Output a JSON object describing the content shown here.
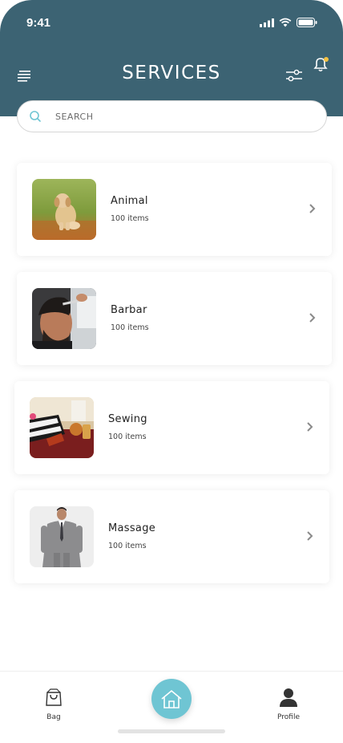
{
  "status_bar": {
    "time": "9:41"
  },
  "header": {
    "title": "SERVICES"
  },
  "search": {
    "placeholder": "SEARCH"
  },
  "services": [
    {
      "title": "Animal",
      "count": "100 items",
      "image": "puppy-photo"
    },
    {
      "title": "Barbar",
      "count": "100 items",
      "image": "barber-photo"
    },
    {
      "title": "Sewing",
      "count": "100 items",
      "image": "sewing-photo"
    },
    {
      "title": "Massage",
      "count": "100 items",
      "image": "suit-man-photo"
    }
  ],
  "bottom_nav": {
    "bag_label": "Bag",
    "profile_label": "Profile"
  },
  "colors": {
    "header": "#3c6373",
    "home_button": "#6fc5d3",
    "notification_dot": "#f5c242"
  },
  "icons": [
    "menu-icon",
    "filter-icon",
    "bell-icon",
    "search-icon",
    "chevron-right-icon",
    "bag-icon",
    "home-icon",
    "profile-icon"
  ]
}
